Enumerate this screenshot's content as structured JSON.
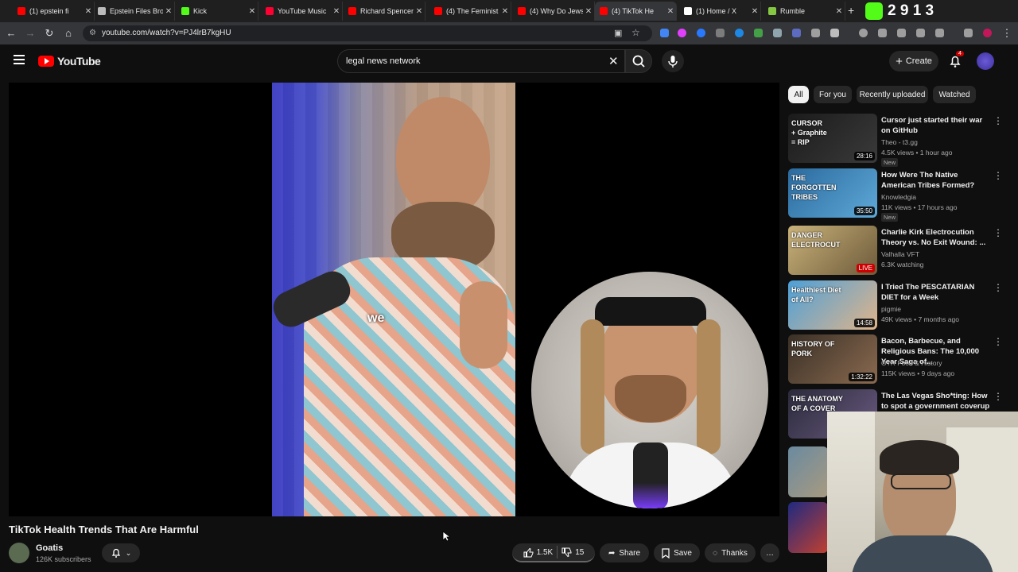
{
  "browser": {
    "tabs": [
      {
        "label": "(1) epstein fi",
        "color": "#ff0000"
      },
      {
        "label": "Epstein Files Bro",
        "color": "#bbbbbb"
      },
      {
        "label": "Kick",
        "color": "#53fc18"
      },
      {
        "label": "YouTube Music",
        "color": "#ff0033"
      },
      {
        "label": "Richard Spencer",
        "color": "#ff0000"
      },
      {
        "label": "(4) The Feminist",
        "color": "#ff0000"
      },
      {
        "label": "(4) Why Do Jews",
        "color": "#ff0000"
      },
      {
        "label": "(4) TikTok He",
        "color": "#ff0000"
      },
      {
        "label": "(1) Home / X",
        "color": "#ffffff"
      },
      {
        "label": "Rumble",
        "color": "#85c742"
      }
    ],
    "new_tab": "+",
    "url": "youtube.com/watch?v=PJ4lrB7kgHU",
    "overlay_counter": "2 9 1 3"
  },
  "header": {
    "logo_text": "YouTube",
    "search_value": "legal news network",
    "create_label": "Create",
    "notif_count": "4"
  },
  "video": {
    "caption": "we",
    "title": "TikTok Health Trends That Are Harmful",
    "channel": "Goatis",
    "subscribers": "126K subscribers",
    "likes": "1.5K",
    "dislikes": "15",
    "share": "Share",
    "save": "Save",
    "thanks": "Thanks"
  },
  "sidebar": {
    "chips": [
      "All",
      "For you",
      "Recently uploaded",
      "Watched"
    ],
    "items": [
      {
        "title": "Cursor just started their war on GitHub",
        "channel": "Theo - t3.gg",
        "meta": "4.5K views • 1 hour ago",
        "badge": "New",
        "duration": "28:16",
        "thumb_text": "CURSOR\n+ Graphite\n= RIP",
        "c1": "#1b1b1b",
        "c2": "#3a3a3a"
      },
      {
        "title": "How Were The Native American Tribes Formed?",
        "channel": "Knowledgia",
        "meta": "11K views • 17 hours ago",
        "badge": "New",
        "duration": "35:50",
        "thumb_text": "THE FORGOTTEN TRIBES",
        "c1": "#2b6a9e",
        "c2": "#5ea9d8"
      },
      {
        "title": "Charlie Kirk Electrocution Theory vs. No Exit Wound: ...",
        "channel": "Valhalla VFT",
        "meta": "6.3K watching",
        "badge": "",
        "duration": "LIVE",
        "thumb_text": "DANGER ELECTROCUT",
        "c1": "#c9b27a",
        "c2": "#6d5a3a"
      },
      {
        "title": "I Tried The PESCATARIAN DIET for a Week",
        "channel": "pigmie",
        "meta": "49K views • 7 months ago",
        "badge": "",
        "duration": "14:58",
        "thumb_text": "Healthiest Diet of All?",
        "c1": "#4da0d8",
        "c2": "#e0b48a"
      },
      {
        "title": "Bacon, Barbecue, and Religious Bans: The 10,000 Year Saga of...",
        "channel": "OTR Food & History",
        "meta": "115K views • 9 days ago",
        "badge": "",
        "duration": "1:32:22",
        "thumb_text": "HISTORY OF PORK",
        "c1": "#3a3026",
        "c2": "#8a6a50"
      },
      {
        "title": "The Las Vegas Sho*ting: How to spot a government coverup 101",
        "channel": "",
        "meta": "",
        "badge": "",
        "duration": "",
        "thumb_text": "THE ANATOMY OF A COVER",
        "c1": "#2a2a3a",
        "c2": "#6a5a80"
      }
    ]
  }
}
